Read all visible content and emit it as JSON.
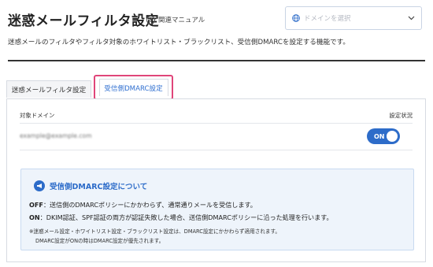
{
  "header": {
    "title": "迷惑メールフィルタ設定",
    "help_link": "関連マニュアル",
    "help_icon": "question-icon",
    "domain_select_placeholder": "ドメインを選択",
    "description": "迷惑メールのフィルタやフィルタ対象のホワイトリスト・ブラックリスト、受信側DMARCを設定する機能です。"
  },
  "tabs": [
    {
      "label": "迷惑メールフィルタ設定",
      "active": false
    },
    {
      "label": "受信側DMARC設定",
      "active": true
    }
  ],
  "table": {
    "col_domain": "対象ドメイン",
    "col_status": "設定状況",
    "rows": [
      {
        "domain": "example@example.com",
        "status": "ON"
      }
    ]
  },
  "info": {
    "title": "受信側DMARC設定について",
    "off_key": "OFF",
    "off_text": "：送信側のDMARCポリシーにかかわらず、通常通りメールを受信します。",
    "on_key": "ON",
    "on_text": "：DKIM認証、SPF認証の両方が認証失敗した場合、送信側DMARCポリシーに沿った処理を行います。",
    "note1": "※迷惑メール設定・ホワイトリスト設定・ブラックリスト設定は、DMARC設定にかかわらず適用されます。",
    "note2": "DMARC設定がONの時はDMARC設定が優先されます。"
  },
  "colors": {
    "accent": "#2d6cc9",
    "highlight_border": "#e0457a",
    "info_bg": "#eef4fb"
  }
}
